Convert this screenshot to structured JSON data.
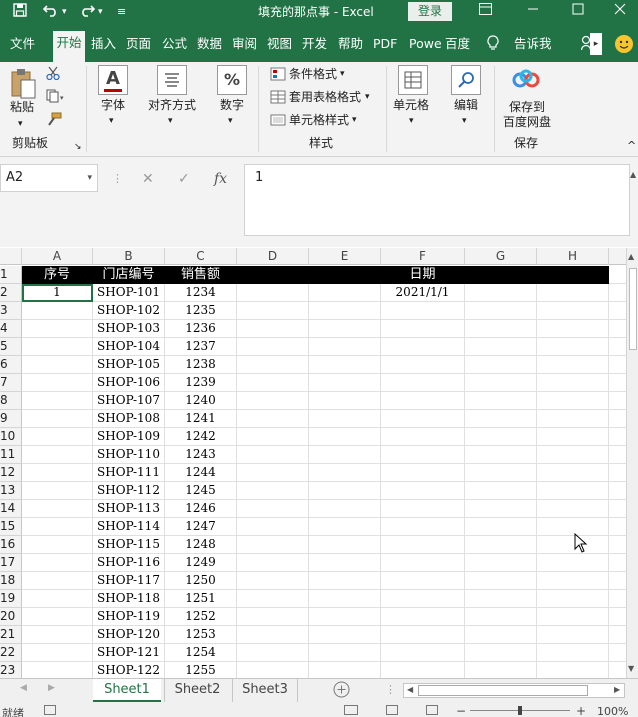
{
  "titlebar": {
    "save_icon": "save-icon",
    "undo_icon": "undo-icon",
    "redo_icon": "redo-icon",
    "title": "填充的那点事  -  Excel",
    "login_label": "登录",
    "restore_icon": "ribbon-display-icon",
    "minimize_icon": "minimize-icon",
    "maximize_icon": "maximize-icon",
    "close_icon": "close-icon"
  },
  "tabs": [
    "文件",
    "开始",
    "插入",
    "页面",
    "公式",
    "数据",
    "审阅",
    "视图",
    "开发",
    "帮助",
    "PDF",
    "Powe",
    "百度",
    "告诉我"
  ],
  "active_tab": "开始",
  "ribbon": {
    "paste_label": "粘贴",
    "clipboard_group": "剪贴板",
    "font_label": "字体",
    "align_label": "对齐方式",
    "number_label": "数字",
    "number_icon_text": "%",
    "font_icon_text": "A",
    "cond_format": "条件格式",
    "table_format": "套用表格格式",
    "cell_style": "单元格样式",
    "style_group": "样式",
    "cells_label": "单元格",
    "edit_label": "编辑",
    "save_baidu_1": "保存到",
    "save_baidu_2": "百度网盘",
    "save_group": "保存"
  },
  "formula_bar": {
    "name_box": "A2",
    "formula": "1",
    "fx_label": "fx"
  },
  "columns": [
    "A",
    "B",
    "C",
    "D",
    "E",
    "F",
    "G",
    "H"
  ],
  "header_row": {
    "A": "序号",
    "B": "门店编号",
    "C": "销售额",
    "F": "日期"
  },
  "rows": [
    {
      "n": "1"
    },
    {
      "n": "2",
      "A": "1",
      "B": "SHOP-101",
      "C": "1234",
      "F": "2021/1/1"
    },
    {
      "n": "3",
      "B": "SHOP-102",
      "C": "1235"
    },
    {
      "n": "4",
      "B": "SHOP-103",
      "C": "1236"
    },
    {
      "n": "5",
      "B": "SHOP-104",
      "C": "1237"
    },
    {
      "n": "6",
      "B": "SHOP-105",
      "C": "1238"
    },
    {
      "n": "7",
      "B": "SHOP-106",
      "C": "1239"
    },
    {
      "n": "8",
      "B": "SHOP-107",
      "C": "1240"
    },
    {
      "n": "9",
      "B": "SHOP-108",
      "C": "1241"
    },
    {
      "n": "10",
      "B": "SHOP-109",
      "C": "1242"
    },
    {
      "n": "11",
      "B": "SHOP-110",
      "C": "1243"
    },
    {
      "n": "12",
      "B": "SHOP-111",
      "C": "1244"
    },
    {
      "n": "13",
      "B": "SHOP-112",
      "C": "1245"
    },
    {
      "n": "14",
      "B": "SHOP-113",
      "C": "1246"
    },
    {
      "n": "15",
      "B": "SHOP-114",
      "C": "1247"
    },
    {
      "n": "16",
      "B": "SHOP-115",
      "C": "1248"
    },
    {
      "n": "17",
      "B": "SHOP-116",
      "C": "1249"
    },
    {
      "n": "18",
      "B": "SHOP-117",
      "C": "1250"
    },
    {
      "n": "19",
      "B": "SHOP-118",
      "C": "1251"
    },
    {
      "n": "20",
      "B": "SHOP-119",
      "C": "1252"
    },
    {
      "n": "21",
      "B": "SHOP-120",
      "C": "1253"
    },
    {
      "n": "22",
      "B": "SHOP-121",
      "C": "1254"
    },
    {
      "n": "23",
      "B": "SHOP-122",
      "C": "1255"
    }
  ],
  "sheets": [
    "Sheet1",
    "Sheet2",
    "Sheet3"
  ],
  "active_sheet": "Sheet1",
  "status": {
    "ready": "就绪",
    "zoom": "100%"
  },
  "colors": {
    "brand": "#217346",
    "header_fill": "#000000"
  }
}
